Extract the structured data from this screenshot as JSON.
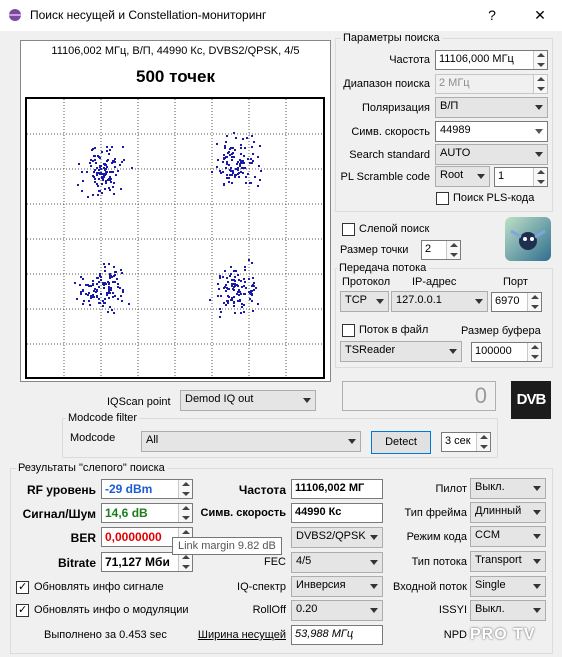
{
  "window": {
    "title": "Поиск несущей и Constellation-мониторинг",
    "help_button": "?",
    "minimize_button": "—",
    "close_button": "✕"
  },
  "constellation": {
    "header": "11106,002 МГц, В/П, 44990 Кс, DVBS2/QPSK, 4/5",
    "points_label": "500 точек"
  },
  "search_params": {
    "group_title": "Параметры поиска",
    "frequency_label": "Частота",
    "frequency_value": "11106,000 МГц",
    "range_label": "Диапазон поиска",
    "range_value": "2 МГц",
    "polarization_label": "Поляризация",
    "polarization_value": "В/П",
    "symbol_rate_label": "Симв. скорость",
    "symbol_rate_value": "44989",
    "search_standard_label": "Search standard",
    "search_standard_value": "AUTO",
    "pl_scramble_label": "PL Scramble code",
    "pl_scramble_mode": "Root",
    "pl_scramble_value": "1",
    "pls_search_label": "Поиск PLS-кода"
  },
  "blind": {
    "blind_search_label": "Слепой поиск",
    "point_size_label": "Размер точки",
    "point_size_value": "2"
  },
  "stream": {
    "group_title": "Передача потока",
    "protocol_label": "Протокол",
    "ip_label": "IP-адрес",
    "port_label": "Порт",
    "protocol_value": "TCP",
    "ip_value": "127.0.0.1",
    "port_value": "6970",
    "to_file_label": "Поток в файл",
    "buffer_label": "Размер буфера",
    "reader_value": "TSReader",
    "buffer_value": "100000"
  },
  "display_counter": "0",
  "iqscan": {
    "label": "IQScan point",
    "value": "Demod IQ out"
  },
  "modcode_filter": {
    "group_title": "Modcode filter",
    "label": "Modcode",
    "value": "All",
    "detect_button": "Detect",
    "timeout_value": "3 сек"
  },
  "results": {
    "group_title": "Результаты \"слепого\" поиска",
    "rf_label": "RF уровень",
    "rf_value": "-29 dBm",
    "snr_label": "Сигнал/Шум",
    "snr_value": "14,6 dB",
    "ber_label": "BER",
    "ber_value": "0,0000000",
    "bitrate_label": "Bitrate",
    "bitrate_value": "71,127 Мби",
    "freq_label": "Частота",
    "freq_value": "11106,002 МГ",
    "sr_label": "Симв. скорость",
    "sr_value": "44990 Кс",
    "mod_value": "DVBS2/QPSK",
    "fec_label": "FEC",
    "fec_value": "4/5",
    "iq_label": "IQ-спектр",
    "iq_value": "Инверсия",
    "rolloff_label": "RollOff",
    "rolloff_value": "0.20",
    "bandwidth_label": "Ширина несущей",
    "bandwidth_value": "53,988 МГц",
    "pilot_label": "Пилот",
    "pilot_value": "Выкл.",
    "frame_label": "Тип фрейма",
    "frame_value": "Длинный",
    "code_mode_label": "Режим кода",
    "code_mode_value": "CCM",
    "stream_type_label": "Тип потока",
    "stream_type_value": "Transport",
    "input_stream_label": "Входной поток",
    "input_stream_value": "Single",
    "issyi_label": "ISSYI",
    "issyi_value": "Выкл.",
    "npd_label": "NPD",
    "update_signal_label": "Обновлять инфо сигнале",
    "update_mod_label": "Обновлять инфо о модуляции",
    "elapsed": "Выполнено за 0.453 sec"
  },
  "tooltip": "Link margin 9.82 dB",
  "watermark": "PRO TV",
  "colors": {
    "rf_text": "#1d5bd4",
    "snr_text": "#1a7f1a",
    "ber_text": "#e00000",
    "dots": "#1a1aa8"
  }
}
